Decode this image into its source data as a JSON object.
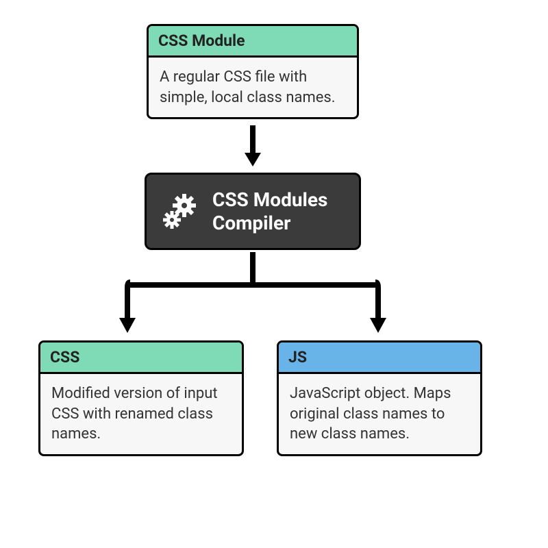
{
  "boxes": {
    "css_module": {
      "title": "CSS Module",
      "description": "A regular CSS file with simple, local class names."
    },
    "compiler": {
      "title_line1": "CSS Modules",
      "title_line2": "Compiler"
    },
    "css_output": {
      "title": "CSS",
      "description": "Modified version of input CSS with renamed class names."
    },
    "js_output": {
      "title": "JS",
      "description": "JavaScript object. Maps original class names to new class names."
    }
  },
  "colors": {
    "green": "#7fdbb6",
    "blue": "#68b3e8",
    "dark": "#3b3b3b"
  }
}
